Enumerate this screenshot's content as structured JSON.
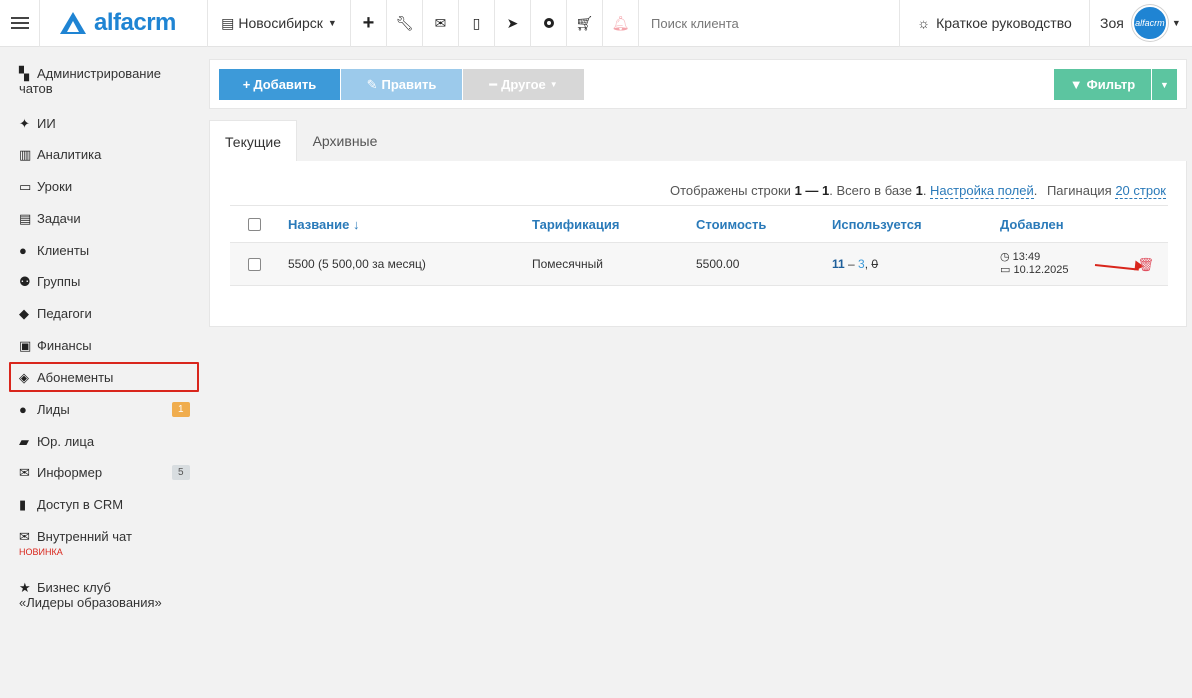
{
  "header": {
    "logo_text": "alfacrm",
    "branch": "Новосибирск",
    "search_placeholder": "Поиск клиента",
    "guide_label": "Краткое руководство",
    "user_name": "Зоя",
    "avatar_text": "alfacrm"
  },
  "sidebar": {
    "items": [
      {
        "label": "Администрирование",
        "label2": "чатов",
        "icon": "chats-icon"
      },
      {
        "label": "ИИ",
        "icon": "sparkle-icon"
      },
      {
        "label": "Аналитика",
        "icon": "map-icon"
      },
      {
        "label": "Уроки",
        "icon": "calendar-icon"
      },
      {
        "label": "Задачи",
        "icon": "clipboard-icon"
      },
      {
        "label": "Клиенты",
        "icon": "user-icon"
      },
      {
        "label": "Группы",
        "icon": "users-icon"
      },
      {
        "label": "Педагоги",
        "icon": "graduation-cap-icon"
      },
      {
        "label": "Финансы",
        "icon": "money-icon"
      },
      {
        "label": "Абонементы",
        "icon": "tag-icon"
      },
      {
        "label": "Лиды",
        "icon": "user-plus-icon",
        "badge": "1"
      },
      {
        "label": "Юр. лица",
        "icon": "briefcase-icon"
      },
      {
        "label": "Информер",
        "icon": "envelope-icon",
        "badge": "5"
      },
      {
        "label": "Доступ в CRM",
        "icon": "lock-icon"
      },
      {
        "label": "Внутренний чат",
        "icon": "envelope-icon",
        "note": "НОВИНКА"
      },
      {
        "label": "Бизнес клуб",
        "label2": "«Лидеры образования»",
        "icon": "star-icon"
      }
    ]
  },
  "toolbar": {
    "add": "Добавить",
    "edit": "Править",
    "other": "Другое",
    "filter": "Фильтр"
  },
  "tabs": {
    "current": "Текущие",
    "archived": "Архивные"
  },
  "info": {
    "shown_prefix": "Отображены строки ",
    "range": "1 — 1",
    "total_prefix": ". Всего в базе ",
    "total": "1",
    "field_settings": "Настройка полей",
    "pagination_label": "Пагинация",
    "pagination_value": "20 строк"
  },
  "table": {
    "columns": [
      "Название ↓",
      "Тарификация",
      "Стоимость",
      "Используется",
      "Добавлен"
    ],
    "rows": [
      {
        "name": "5500 (5 500,00 за месяц)",
        "billing": "Помесячный",
        "cost": "5500.00",
        "uses_total": "11",
        "uses_active": "3",
        "uses_zero": "0",
        "time": "13:49",
        "date": "10.12.2025"
      }
    ]
  },
  "colors": {
    "primary": "#3d9ad9",
    "filter": "#5cc5a0",
    "highlight": "#d9261c"
  }
}
